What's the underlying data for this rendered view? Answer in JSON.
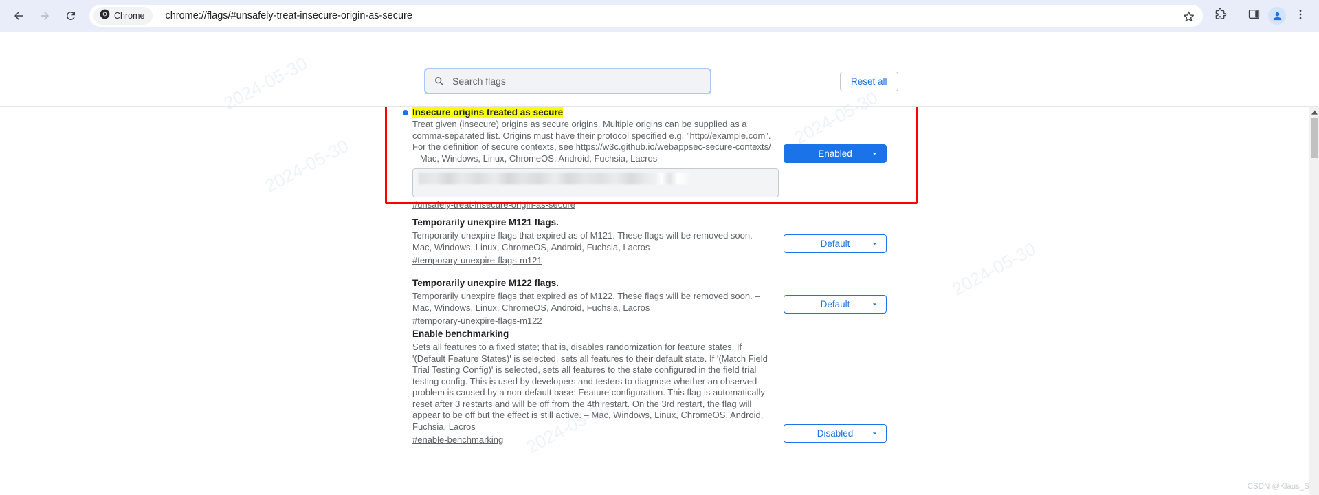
{
  "browser": {
    "back_icon": "arrow-left-icon",
    "forward_icon": "arrow-right-icon",
    "reload_icon": "reload-icon",
    "chrome_chip_label": "Chrome",
    "url": "chrome://flags/#unsafely-treat-insecure-origin-as-secure",
    "bookmark_icon": "star-icon",
    "extensions_icon": "puzzle-piece-icon",
    "side_panel_icon": "side-panel-icon",
    "profile_icon": "profile-avatar-icon",
    "menu_icon": "three-dot-menu-icon"
  },
  "search": {
    "placeholder": "Search flags",
    "value": "",
    "icon": "search-icon"
  },
  "toolbar": {
    "reset_all_label": "Reset all"
  },
  "colors": {
    "accent_blue": "#1a73e8",
    "highlight_yellow": "#ffff00",
    "callout_red": "#ff0000",
    "toolbar_bg": "#e9edfa"
  },
  "flags": [
    {
      "title": "Insecure origins treated as secure",
      "highlighted": true,
      "has_dot": true,
      "description": "Treat given (insecure) origins as secure origins. Multiple origins can be supplied as a comma-separated list. Origins must have their protocol specified e.g. \"http://example.com\". For the definition of secure contexts, see https://w3c.github.io/webappsec-secure-contexts/ – Mac, Windows, Linux, ChromeOS, Android, Fuchsia, Lacros",
      "permalink": "#unsafely-treat-insecure-origin-as-secure",
      "has_textarea": true,
      "textarea_value": "",
      "select_value": "Enabled",
      "select_state": "enabled"
    },
    {
      "title": "Temporarily unexpire M121 flags.",
      "highlighted": false,
      "has_dot": false,
      "description": "Temporarily unexpire flags that expired as of M121. These flags will be removed soon. – Mac, Windows, Linux, ChromeOS, Android, Fuchsia, Lacros",
      "permalink": "#temporary-unexpire-flags-m121",
      "has_textarea": false,
      "textarea_value": "",
      "select_value": "Default",
      "select_state": "default"
    },
    {
      "title": "Temporarily unexpire M122 flags.",
      "highlighted": false,
      "has_dot": false,
      "description": "Temporarily unexpire flags that expired as of M122. These flags will be removed soon. – Mac, Windows, Linux, ChromeOS, Android, Fuchsia, Lacros",
      "permalink": "#temporary-unexpire-flags-m122",
      "has_textarea": false,
      "textarea_value": "",
      "select_value": "Default",
      "select_state": "default"
    },
    {
      "title": "Enable benchmarking",
      "highlighted": false,
      "has_dot": false,
      "description": "Sets all features to a fixed state; that is, disables randomization for feature states. If '(Default Feature States)' is selected, sets all features to their default state. If '(Match Field Trial Testing Config)' is selected, sets all features to the state configured in the field trial testing config. This is used by developers and testers to diagnose whether an observed problem is caused by a non-default base::Feature configuration. This flag is automatically reset after 3 restarts and will be off from the 4th restart. On the 3rd restart, the flag will appear to be off but the effect is still active. – Mac, Windows, Linux, ChromeOS, Android, Fuchsia, Lacros",
      "permalink": "#enable-benchmarking",
      "has_textarea": false,
      "textarea_value": "",
      "select_value": "Disabled",
      "select_state": "disabled"
    }
  ],
  "watermark": "CSDN @Klaus_S"
}
